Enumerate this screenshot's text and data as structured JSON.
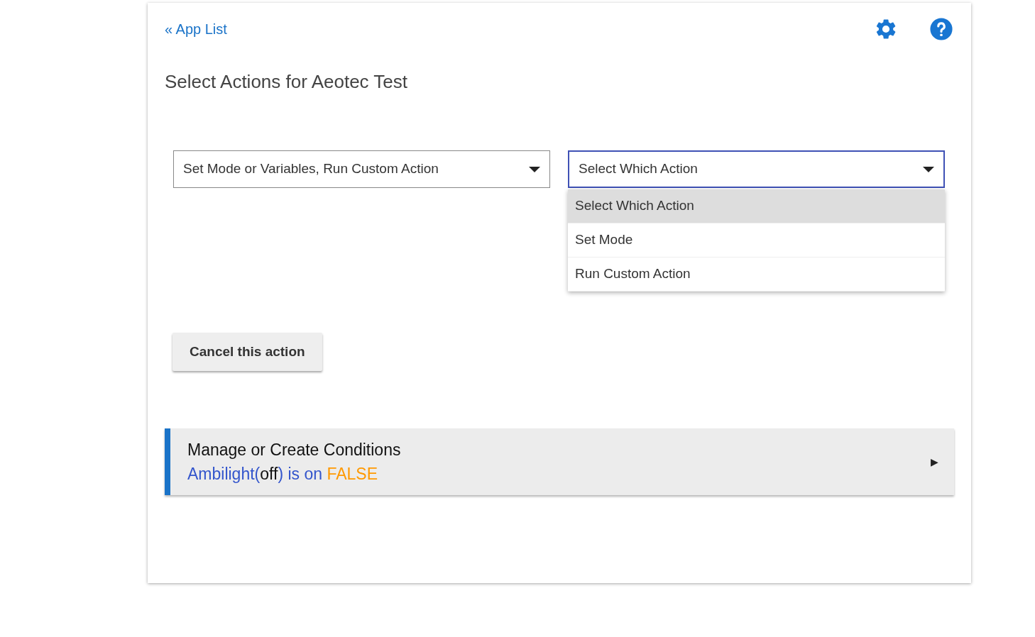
{
  "header": {
    "back_link": "« App List"
  },
  "title": "Select Actions for Aeotec Test",
  "selects": [
    {
      "value": "Set Mode or Variables, Run Custom Action",
      "focused": false
    },
    {
      "value": "Select Which Action",
      "focused": true,
      "options": [
        {
          "label": "Select Which Action",
          "selected": true
        },
        {
          "label": "Set Mode",
          "selected": false
        },
        {
          "label": "Run Custom Action",
          "selected": false
        }
      ]
    }
  ],
  "cancel_button": "Cancel this action",
  "conditions": {
    "title": "Manage or Create Conditions",
    "expanded": false,
    "arrow": "▶",
    "summary": [
      {
        "text": "Ambilight(",
        "color": "#3355cc"
      },
      {
        "text": "off",
        "color": "#111111"
      },
      {
        "text": ") is on ",
        "color": "#3355cc"
      },
      {
        "text": "FALSE",
        "color": "#ff9900"
      }
    ]
  }
}
